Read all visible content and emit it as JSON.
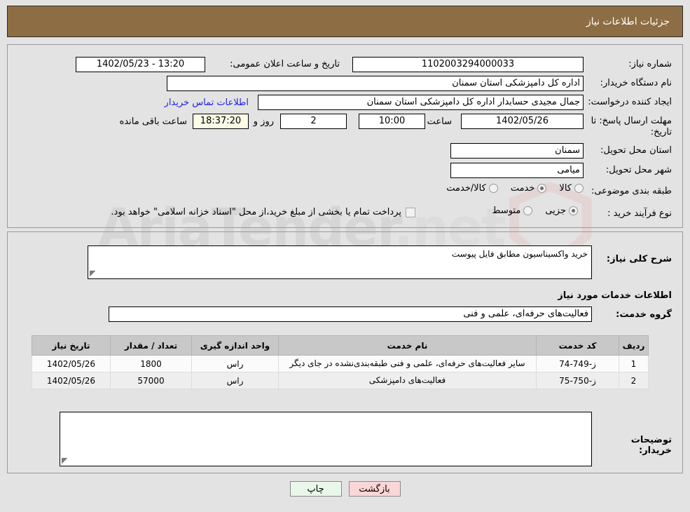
{
  "header": {
    "title": "جزئیات اطلاعات نیاز"
  },
  "watermark": {
    "text": "AriaTender",
    "suffix": ".net"
  },
  "form": {
    "need_number": {
      "label": "شماره نیاز:",
      "value": "1102003294000033"
    },
    "announce_datetime": {
      "label": "تاریخ و ساعت اعلان عمومی:",
      "value": "13:20 - 1402/05/23"
    },
    "buyer_org": {
      "label": "نام دستگاه خریدار:",
      "value": "اداره کل دامپزشکی استان سمنان"
    },
    "creator": {
      "label": "ایجاد کننده درخواست:",
      "value": "جمال مجیدی حسابدار اداره کل دامپزشکی استان سمنان"
    },
    "contact_link": {
      "label": "اطلاعات تماس خریدار"
    },
    "deadline": {
      "label": "مهلت ارسال پاسخ: تا تاریخ:",
      "date": "1402/05/26",
      "time_label": "ساعت",
      "time": "10:00",
      "days": "2",
      "days_label": "روز و",
      "remaining": "18:37:20",
      "remaining_label": "ساعت باقی مانده"
    },
    "province": {
      "label": "استان محل تحویل:",
      "value": "سمنان"
    },
    "city": {
      "label": "شهر محل تحویل:",
      "value": "میامی"
    },
    "category": {
      "label": "طبقه بندی موضوعی:",
      "options": [
        {
          "label": "کالا",
          "selected": false
        },
        {
          "label": "خدمت",
          "selected": true
        },
        {
          "label": "کالا/خدمت",
          "selected": false
        }
      ]
    },
    "process_type": {
      "label": "نوع فرآیند خرید :",
      "options": [
        {
          "label": "جزیی",
          "selected": true
        },
        {
          "label": "متوسط",
          "selected": false
        }
      ]
    },
    "treasury_note": {
      "label": "پرداخت تمام یا بخشی از مبلغ خرید،از محل \"اسناد خزانه اسلامی\" خواهد بود.",
      "checked": false
    }
  },
  "description": {
    "label": "شرح کلی نیاز:",
    "value": "خرید واکسیناسیون مطابق فایل پیوست"
  },
  "services_section": {
    "heading": "اطلاعات خدمات مورد نیاز",
    "group_label": "گروه خدمت:",
    "group_value": "فعالیت‌های حرفه‌ای، علمی و فنی"
  },
  "table": {
    "headers": [
      "ردیف",
      "کد خدمت",
      "نام خدمت",
      "واحد اندازه گیری",
      "تعداد / مقدار",
      "تاریخ نیاز"
    ],
    "rows": [
      {
        "row": "1",
        "code": "ز-749-74",
        "name": "سایر فعالیت‌های حرفه‌ای، علمی و فنی طبقه‌بندی‌نشده در جای دیگر",
        "unit": "راس",
        "qty": "1800",
        "date": "1402/05/26"
      },
      {
        "row": "2",
        "code": "ز-750-75",
        "name": "فعالیت‌های دامپزشکی",
        "unit": "راس",
        "qty": "57000",
        "date": "1402/05/26"
      }
    ]
  },
  "buyer_comments": {
    "label": "توضیحات خریدار:",
    "value": ""
  },
  "buttons": {
    "print": "چاپ",
    "back": "بازگشت"
  },
  "colors": {
    "header_bar": "#8d6d43",
    "link": "#2222dd",
    "table_header": "#c8c8c8",
    "timer_bg": "#fbfbe8",
    "print_btn": "#e9f7e9",
    "back_btn": "#fbd6d6",
    "page_bg": "#e3e3e3"
  }
}
